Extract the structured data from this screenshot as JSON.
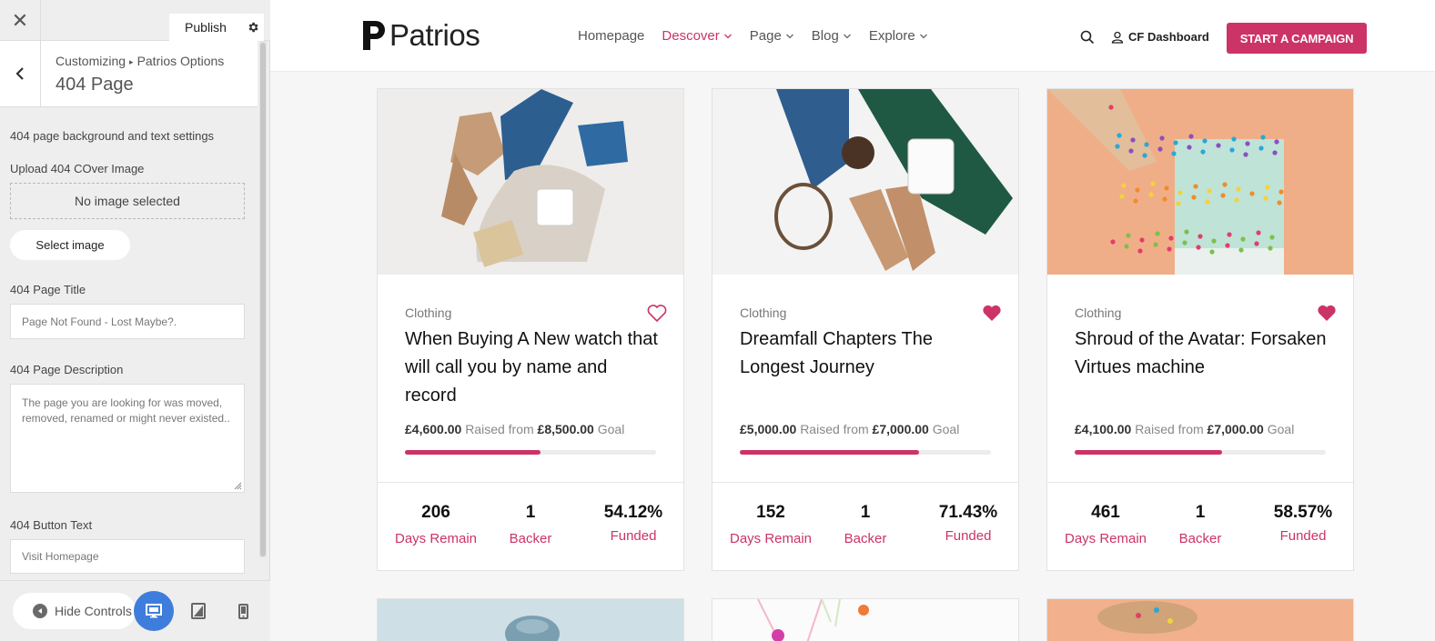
{
  "customizer": {
    "close": "✕",
    "publish": "Publish",
    "breadcrumb": {
      "root": "Customizing",
      "separator": "▸",
      "section": "Patrios Options"
    },
    "section_title": "404 Page",
    "intro_text": "404 page background and text settings",
    "cover_label": "Upload 404 COver Image",
    "no_image": "No image selected",
    "select_image": "Select image",
    "title_label": "404 Page Title",
    "title_value": "Page Not Found - Lost Maybe?.",
    "description_label": "404 Page Description",
    "description_value": "The page you are looking for was moved, removed, renamed or might never existed..",
    "button_label": "404 Button Text",
    "button_value": "Visit Homepage",
    "hide_controls": "Hide Controls"
  },
  "site": {
    "logo": "Patrios",
    "nav": [
      {
        "label": "Homepage",
        "dropdown": false,
        "active": false
      },
      {
        "label": "Descover",
        "dropdown": true,
        "active": true
      },
      {
        "label": "Page",
        "dropdown": true,
        "active": false
      },
      {
        "label": "Blog",
        "dropdown": true,
        "active": false
      },
      {
        "label": "Explore",
        "dropdown": true,
        "active": false
      }
    ],
    "dashboard": "CF Dashboard",
    "cta": "START A CAMPAIGN",
    "accent": "#cc3366"
  },
  "campaigns": [
    {
      "category": "Clothing",
      "title": "When Buying A New watch that will call you by name and record",
      "raised": "£4,600.00",
      "raised_text": "Raised from",
      "goal": "£8,500.00",
      "goal_text": "Goal",
      "progress": 0.5412,
      "favorited": false,
      "days": "206",
      "days_label": "Days Remain",
      "backers": "1",
      "backers_label": "Backer",
      "funded": "54.12%",
      "funded_label": "Funded"
    },
    {
      "category": "Clothing",
      "title": "Dreamfall Chapters The Longest Journey",
      "raised": "£5,000.00",
      "raised_text": "Raised from",
      "goal": "£7,000.00",
      "goal_text": "Goal",
      "progress": 0.7143,
      "favorited": true,
      "days": "152",
      "days_label": "Days Remain",
      "backers": "1",
      "backers_label": "Backer",
      "funded": "71.43%",
      "funded_label": "Funded"
    },
    {
      "category": "Clothing",
      "title": "Shroud of the Avatar: Forsaken Virtues machine",
      "raised": "£4,100.00",
      "raised_text": "Raised from",
      "goal": "£7,000.00",
      "goal_text": "Goal",
      "progress": 0.5857,
      "favorited": true,
      "days": "461",
      "days_label": "Days Remain",
      "backers": "1",
      "backers_label": "Backer",
      "funded": "58.57%",
      "funded_label": "Funded"
    }
  ]
}
